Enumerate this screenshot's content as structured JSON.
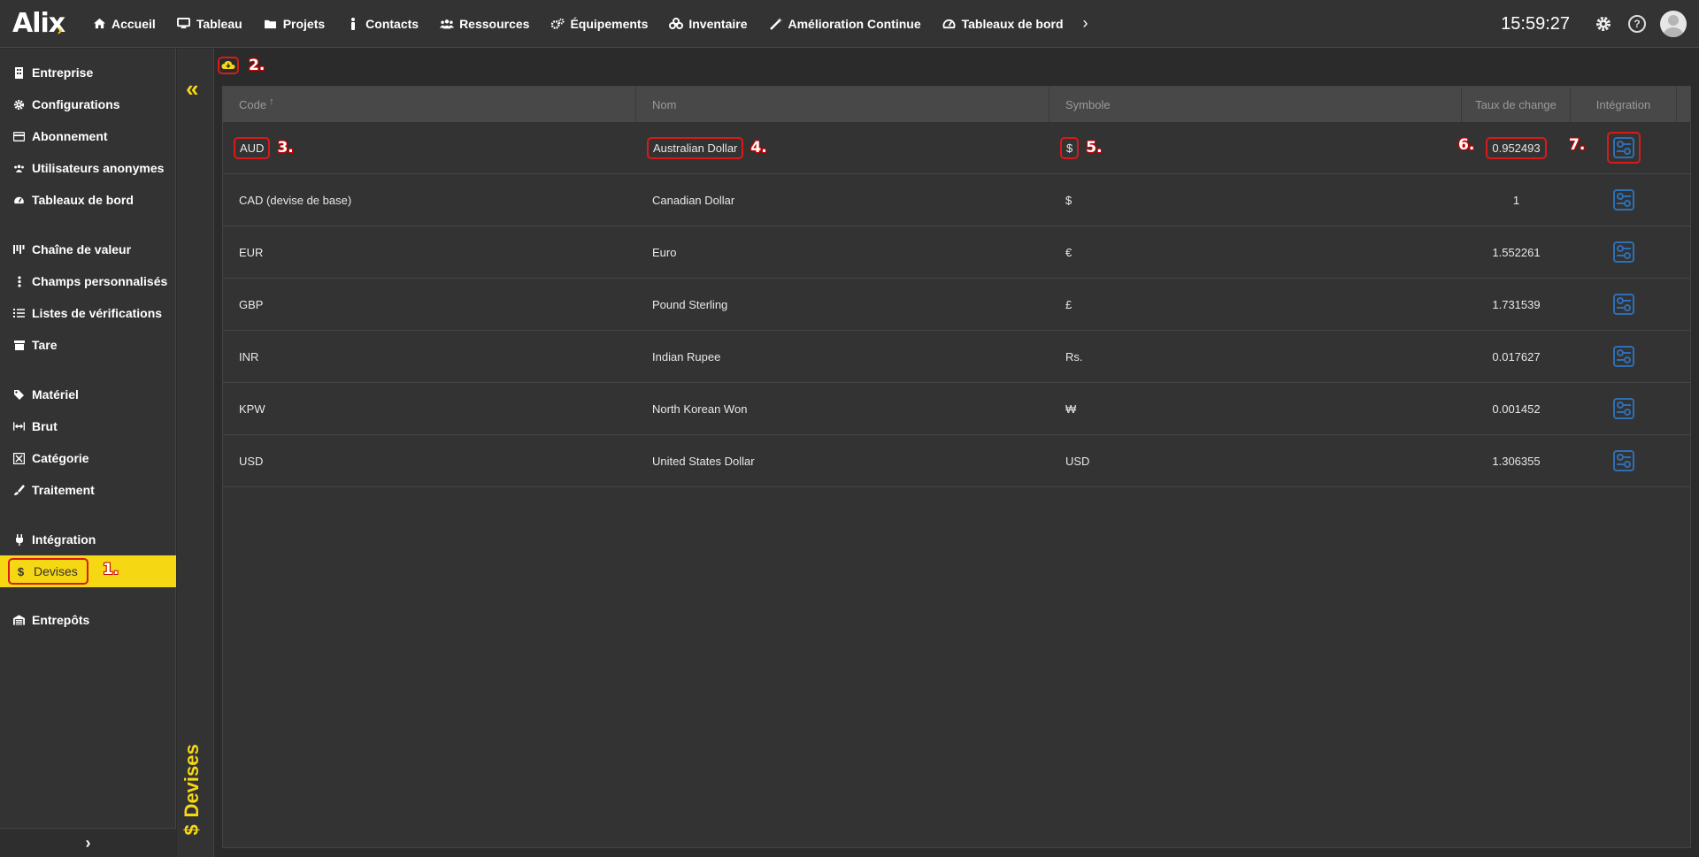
{
  "app": {
    "logo_text": "Alix",
    "clock": "15:59:27"
  },
  "nav": [
    {
      "label": "Accueil",
      "icon": "home-icon"
    },
    {
      "label": "Tableau",
      "icon": "monitor-icon"
    },
    {
      "label": "Projets",
      "icon": "folder-icon"
    },
    {
      "label": "Contacts",
      "icon": "person-icon"
    },
    {
      "label": "Ressources",
      "icon": "users-icon"
    },
    {
      "label": "Équipements",
      "icon": "cogs-icon"
    },
    {
      "label": "Inventaire",
      "icon": "boxes-icon"
    },
    {
      "label": "Amélioration Continue",
      "icon": "magic-wand-icon"
    },
    {
      "label": "Tableaux de bord",
      "icon": "dashboard-gauge-icon"
    }
  ],
  "sidebar": {
    "items": [
      {
        "label": "Entreprise",
        "icon": "building-icon"
      },
      {
        "label": "Configurations",
        "icon": "gear-icon"
      },
      {
        "label": "Abonnement",
        "icon": "card-icon"
      },
      {
        "label": "Utilisateurs anonymes",
        "icon": "users-icon"
      },
      {
        "label": "Tableaux de bord",
        "icon": "dashboard-gauge-icon"
      },
      {
        "label": "Chaîne de valeur",
        "icon": "value-chain-icon"
      },
      {
        "label": "Champs personnalisés",
        "icon": "vertical-dots-icon"
      },
      {
        "label": "Listes de vérifications",
        "icon": "checklist-icon"
      },
      {
        "label": "Tare",
        "icon": "archive-icon"
      },
      {
        "label": "Matériel",
        "icon": "tag-icon"
      },
      {
        "label": "Brut",
        "icon": "arrows-horizontal-icon"
      },
      {
        "label": "Catégorie",
        "icon": "category-icon"
      },
      {
        "label": "Traitement",
        "icon": "brush-icon"
      },
      {
        "label": "Intégration",
        "icon": "plug-icon"
      },
      {
        "label": "Devises",
        "icon": "dollar-icon"
      },
      {
        "label": "Entrepôts",
        "icon": "warehouse-icon"
      }
    ],
    "active": "Devises"
  },
  "page": {
    "title": "Devises"
  },
  "callouts": [
    "1.",
    "2.",
    "3.",
    "4.",
    "5.",
    "6.",
    "7."
  ],
  "table": {
    "columns": [
      "Code",
      "Nom",
      "Symbole",
      "Taux de change",
      "Intégration"
    ],
    "sort_indicator": "↑",
    "rows": [
      {
        "code": "AUD",
        "name": "Australian Dollar",
        "symbol": "$",
        "rate": "0.952493"
      },
      {
        "code": "CAD (devise de base)",
        "name": "Canadian Dollar",
        "symbol": "$",
        "rate": "1"
      },
      {
        "code": "EUR",
        "name": "Euro",
        "symbol": "€",
        "rate": "1.552261"
      },
      {
        "code": "GBP",
        "name": "Pound Sterling",
        "symbol": "£",
        "rate": "1.731539"
      },
      {
        "code": "INR",
        "name": "Indian Rupee",
        "symbol": "Rs.",
        "rate": "0.017627"
      },
      {
        "code": "KPW",
        "name": "North Korean Won",
        "symbol": "₩",
        "rate": "0.001452"
      },
      {
        "code": "USD",
        "name": "United States Dollar",
        "symbol": "USD",
        "rate": "1.306355"
      }
    ]
  },
  "colors": {
    "accent": "#f5d714",
    "highlight": "#d91a1a",
    "integration_icon": "#2f6fb5",
    "background": "#333333"
  }
}
